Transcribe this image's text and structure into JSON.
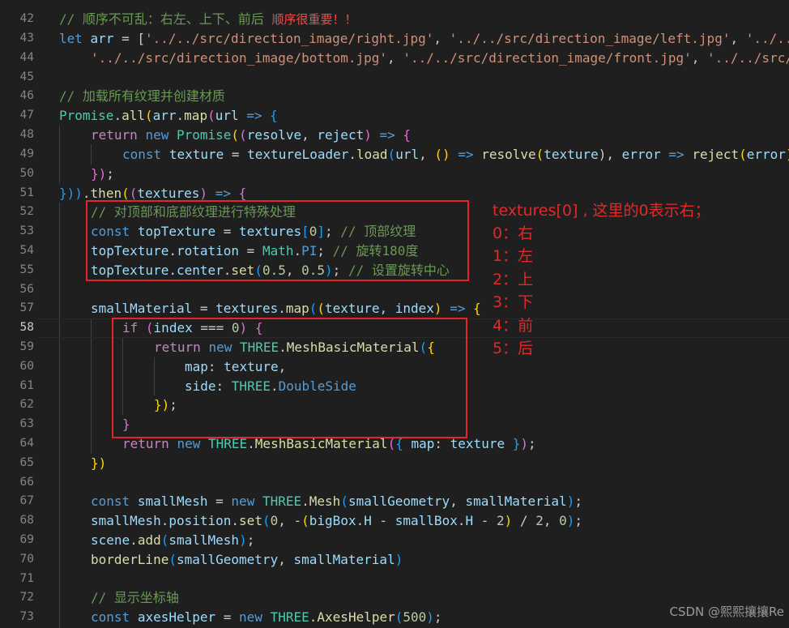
{
  "editor": {
    "current_line": "58",
    "lines": {
      "l42": {
        "num": "42",
        "t": [
          "// 顺序不可乱：右左、上下、前后",
          "  顺序很重要！！"
        ]
      },
      "l43": {
        "num": "43",
        "t": [
          "let",
          " ",
          "arr",
          " = [",
          "'../../src/direction_image/right.jpg'",
          ", ",
          "'../../src/direction_image/left.jpg'",
          ", ",
          "'../../"
        ]
      },
      "l44": {
        "num": "44",
        "t": [
          "'../../src/direction_image/bottom.jpg'",
          ", ",
          "'../../src/direction_image/front.jpg'",
          ", ",
          "'../../src/"
        ]
      },
      "l45": {
        "num": "45",
        "t": []
      },
      "l46": {
        "num": "46",
        "t": [
          "// 加载所有纹理并创建材质"
        ]
      },
      "l47": {
        "num": "47",
        "t": [
          "Promise",
          ".",
          "all",
          "(",
          "arr",
          ".",
          "map",
          "(",
          "url",
          " ",
          "=>",
          " {"
        ]
      },
      "l48": {
        "num": "48",
        "t": [
          "return",
          " ",
          "new",
          " ",
          "Promise",
          "(",
          "(",
          "resolve",
          ", ",
          "reject",
          ")",
          " ",
          "=>",
          " ",
          "{"
        ]
      },
      "l49": {
        "num": "49",
        "t": [
          "const",
          " ",
          "texture",
          " = ",
          "textureLoader",
          ".",
          "load",
          "(",
          "url",
          ", ",
          "()",
          " ",
          "=>",
          " ",
          "resolve",
          "(",
          "texture",
          "), ",
          "error",
          " ",
          "=>",
          " ",
          "reject",
          "(",
          "error",
          ")"
        ]
      },
      "l50": {
        "num": "50",
        "t": [
          "})",
          ";"
        ]
      },
      "l51": {
        "num": "51",
        "t": [
          "}))",
          ".",
          "then",
          "(",
          "(",
          "textures",
          ")",
          " ",
          "=>",
          " ",
          "{"
        ]
      },
      "l52": {
        "num": "52",
        "t": [
          "// 对顶部和底部纹理进行特殊处理"
        ]
      },
      "l53": {
        "num": "53",
        "t": [
          "const",
          " ",
          "topTexture",
          " = ",
          "textures",
          "[",
          "0",
          "]",
          "; ",
          "// 顶部纹理"
        ]
      },
      "l54": {
        "num": "54",
        "t": [
          "topTexture",
          ".",
          "rotation",
          " = ",
          "Math",
          ".",
          "PI",
          "; ",
          "// 旋转180度"
        ]
      },
      "l55": {
        "num": "55",
        "t": [
          "topTexture",
          ".",
          "center",
          ".",
          "set",
          "(",
          "0.5",
          ", ",
          "0.5",
          ")",
          "; ",
          "// 设置旋转中心"
        ]
      },
      "l56": {
        "num": "56",
        "t": []
      },
      "l57": {
        "num": "57",
        "t": [
          "smallMaterial",
          " = ",
          "textures",
          ".",
          "map",
          "(",
          "(",
          "texture",
          ", ",
          "index",
          ")",
          " ",
          "=>",
          " ",
          "{"
        ]
      },
      "l58": {
        "num": "58",
        "t": [
          "if",
          " ",
          "(",
          "index",
          " === ",
          "0",
          ")",
          " ",
          "{"
        ]
      },
      "l59": {
        "num": "59",
        "t": [
          "return",
          " ",
          "new",
          " ",
          "THREE",
          ".",
          "MeshBasicMaterial",
          "(",
          "{"
        ]
      },
      "l60": {
        "num": "60",
        "t": [
          "map",
          ": ",
          "texture",
          ","
        ]
      },
      "l61": {
        "num": "61",
        "t": [
          "side",
          ": ",
          "THREE",
          ".",
          "DoubleSide"
        ]
      },
      "l62": {
        "num": "62",
        "t": [
          "})",
          ";"
        ]
      },
      "l63": {
        "num": "63",
        "t": [
          "}"
        ]
      },
      "l64": {
        "num": "64",
        "t": [
          "return",
          " ",
          "new",
          " ",
          "THREE",
          ".",
          "MeshBasicMaterial",
          "(",
          "{",
          " ",
          "map",
          ": ",
          "texture",
          " ",
          "}",
          ")",
          ";"
        ]
      },
      "l65": {
        "num": "65",
        "t": [
          "})"
        ]
      },
      "l66": {
        "num": "66",
        "t": []
      },
      "l67": {
        "num": "67",
        "t": [
          "const",
          " ",
          "smallMesh",
          " = ",
          "new",
          " ",
          "THREE",
          ".",
          "Mesh",
          "(",
          "smallGeometry",
          ", ",
          "smallMaterial",
          ")",
          ";"
        ]
      },
      "l68": {
        "num": "68",
        "t": [
          "smallMesh",
          ".",
          "position",
          ".",
          "set",
          "(",
          "0",
          ", -",
          "(",
          "bigBox",
          ".",
          "H",
          " - ",
          "smallBox",
          ".",
          "H",
          " - ",
          "2",
          ")",
          " / ",
          "2",
          ", ",
          "0",
          ")",
          ";"
        ]
      },
      "l69": {
        "num": "69",
        "t": [
          "scene",
          ".",
          "add",
          "(",
          "smallMesh",
          ")",
          ";"
        ]
      },
      "l70": {
        "num": "70",
        "t": [
          "borderLine",
          "(",
          "smallGeometry",
          ", ",
          "smallMaterial",
          ")"
        ]
      },
      "l71": {
        "num": "71",
        "t": []
      },
      "l72": {
        "num": "72",
        "t": [
          "// 显示坐标轴"
        ]
      },
      "l73": {
        "num": "73",
        "t": [
          "const",
          " ",
          "axesHelper",
          " = ",
          "new",
          " ",
          "THREE",
          ".",
          "AxesHelper",
          "(",
          "500",
          ")",
          ";"
        ]
      }
    }
  },
  "annotation": {
    "title": "textures[0] , 这里的0表示右；",
    "items": [
      "0：右",
      "1：左",
      "2：上",
      "3：下",
      "4：前",
      "5：后"
    ]
  },
  "watermark": "CSDN @熙熙攘攘Re",
  "colors": {
    "background": "#1f1f1f",
    "annotation_red": "#e5252b",
    "keyword": "#569cd6",
    "control_keyword": "#c586c0",
    "function": "#dcdcaa",
    "variable": "#9cdcfe",
    "class": "#4ec9b0",
    "string": "#ce9178",
    "number": "#b5cea8",
    "comment": "#6a9955"
  }
}
